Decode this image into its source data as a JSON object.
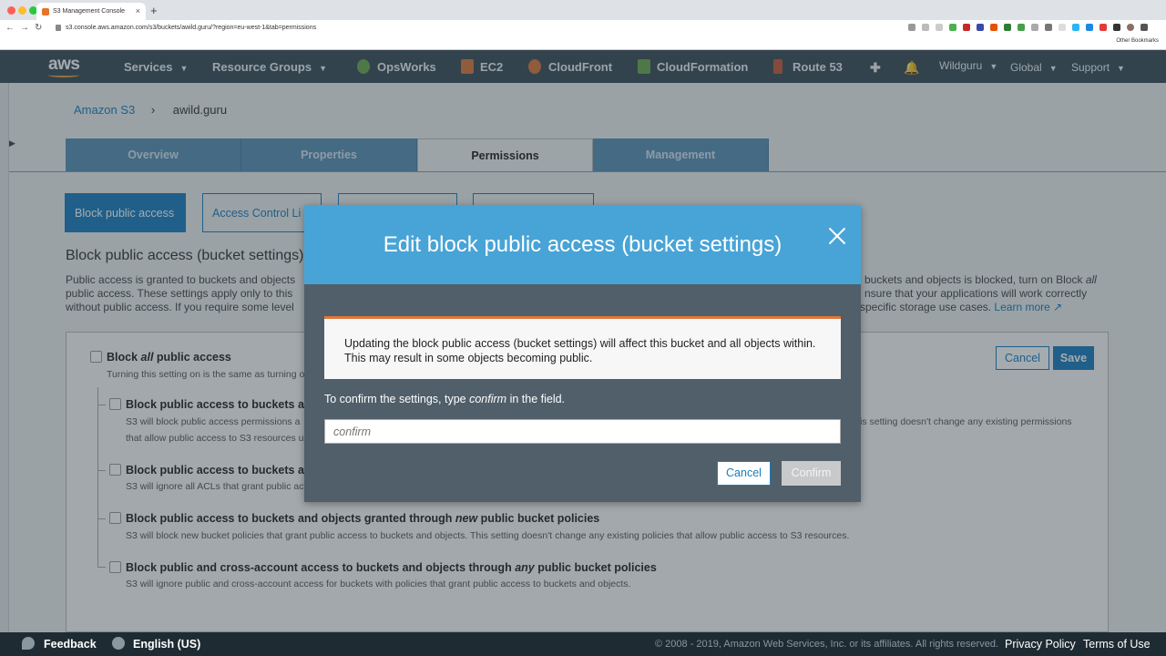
{
  "browser": {
    "tab_title": "S3 Management Console",
    "url": "s3.console.aws.amazon.com/s3/buckets/awild.guru/?region=eu-west-1&tab=permissions",
    "bookmarks_label": "Other Bookmarks"
  },
  "aws_nav": {
    "logo": "aws",
    "services": "Services",
    "resource_groups": "Resource Groups",
    "shortcuts": [
      "OpsWorks",
      "EC2",
      "CloudFront",
      "CloudFormation",
      "Route 53"
    ],
    "user": "Wildguru",
    "region": "Global",
    "support": "Support",
    "colors": {
      "bar": "#3a4d58",
      "accent": "#e9a03b"
    }
  },
  "breadcrumb": {
    "root": "Amazon S3",
    "sep": "›",
    "bucket": "awild.guru"
  },
  "tabs": [
    "Overview",
    "Properties",
    "Permissions",
    "Management"
  ],
  "active_tab": "Permissions",
  "subtabs": {
    "active": "Block public access",
    "next": "Access Control Li"
  },
  "section": {
    "title": "Block public access (bucket settings)",
    "para_left_1": "Public access is granted to buckets and objects",
    "para_left_2": "public access. These settings apply only to this",
    "para_left_3": "without public access. If you require some level",
    "para_right_1a": "buckets and objects is blocked, turn on Block ",
    "para_right_1b": "all",
    "para_right_2": "nsure that your applications will work correctly",
    "para_right_3": "specific storage use cases.",
    "learn_more": "Learn more"
  },
  "panel": {
    "cancel": "Cancel",
    "save": "Save",
    "master_prefix": "Block ",
    "master_em": "all",
    "master_suffix": " public access",
    "master_desc": "Turning this setting on is the same as turning o",
    "options": [
      {
        "title": "Block public access to buckets ar",
        "desc1": "S3 will block public access permissions a",
        "desc2": "that allow public access to S3 resources u",
        "desc_right": "is setting doesn't change any existing permissions"
      },
      {
        "title": "Block public access to buckets ar",
        "desc1": "S3 will ignore all ACLs that grant public ac"
      },
      {
        "title_a": "Block public access to buckets and objects granted through ",
        "title_em": "new",
        "title_b": " public bucket policies",
        "desc1": "S3 will block new bucket policies that grant public access to buckets and objects. This setting doesn't change any existing policies that allow public access to S3 resources."
      },
      {
        "title_a": "Block public and cross-account access to buckets and objects through ",
        "title_em": "any",
        "title_b": " public bucket policies",
        "desc1": "S3 will ignore public and cross-account access for buckets with policies that grant public access to buckets and objects."
      }
    ]
  },
  "modal": {
    "title": "Edit block public access (bucket settings)",
    "warning": "Updating the block public access (bucket settings) will affect this bucket and all objects within. This may result in some objects becoming public.",
    "prompt_a": "To confirm the settings, type ",
    "prompt_em": "confirm",
    "prompt_b": " in the field.",
    "input_placeholder": "confirm",
    "input_value": "",
    "cancel": "Cancel",
    "confirm": "Confirm",
    "colors": {
      "header": "#48a4d6",
      "warning_border": "#e2773a"
    }
  },
  "footer": {
    "feedback": "Feedback",
    "language": "English (US)",
    "copyright": "© 2008 - 2019, Amazon Web Services, Inc. or its affiliates. All rights reserved.",
    "privacy": "Privacy Policy",
    "terms": "Terms of Use"
  }
}
